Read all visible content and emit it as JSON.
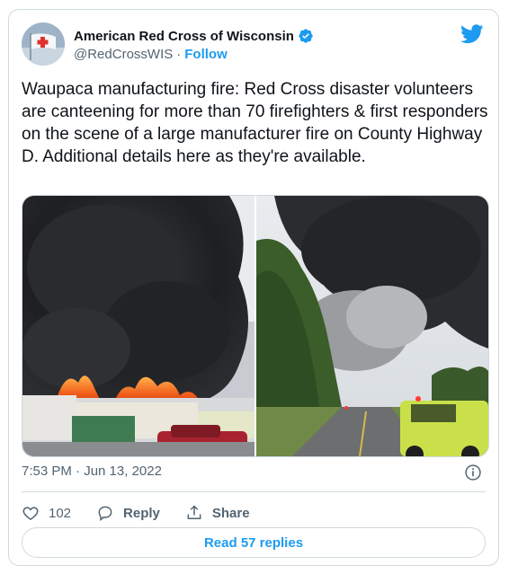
{
  "account": {
    "display_name": "American Red Cross of Wisconsin",
    "handle": "@RedCrossWIS",
    "separator": "·",
    "follow_label": "Follow"
  },
  "tweet": {
    "text": "Waupaca manufacturing fire: Red Cross disaster volunteers are canteening for more than 70 firefighters & first responders on the scene of a large manufacturer fire on County Highway D. Additional details here as they're available.",
    "time": "7:53 PM · Jun 13, 2022"
  },
  "actions": {
    "like_count": "102",
    "reply_label": "Reply",
    "share_label": "Share"
  },
  "footer": {
    "read_replies_label": "Read 57 replies"
  },
  "colors": {
    "accent": "#1d9bf0",
    "text": "#0f1419",
    "muted": "#536471",
    "border": "#cfd9de"
  },
  "icons": [
    "red-cross-avatar",
    "verified-badge-icon",
    "twitter-bird-icon",
    "info-icon",
    "heart-icon",
    "reply-icon",
    "share-icon"
  ]
}
